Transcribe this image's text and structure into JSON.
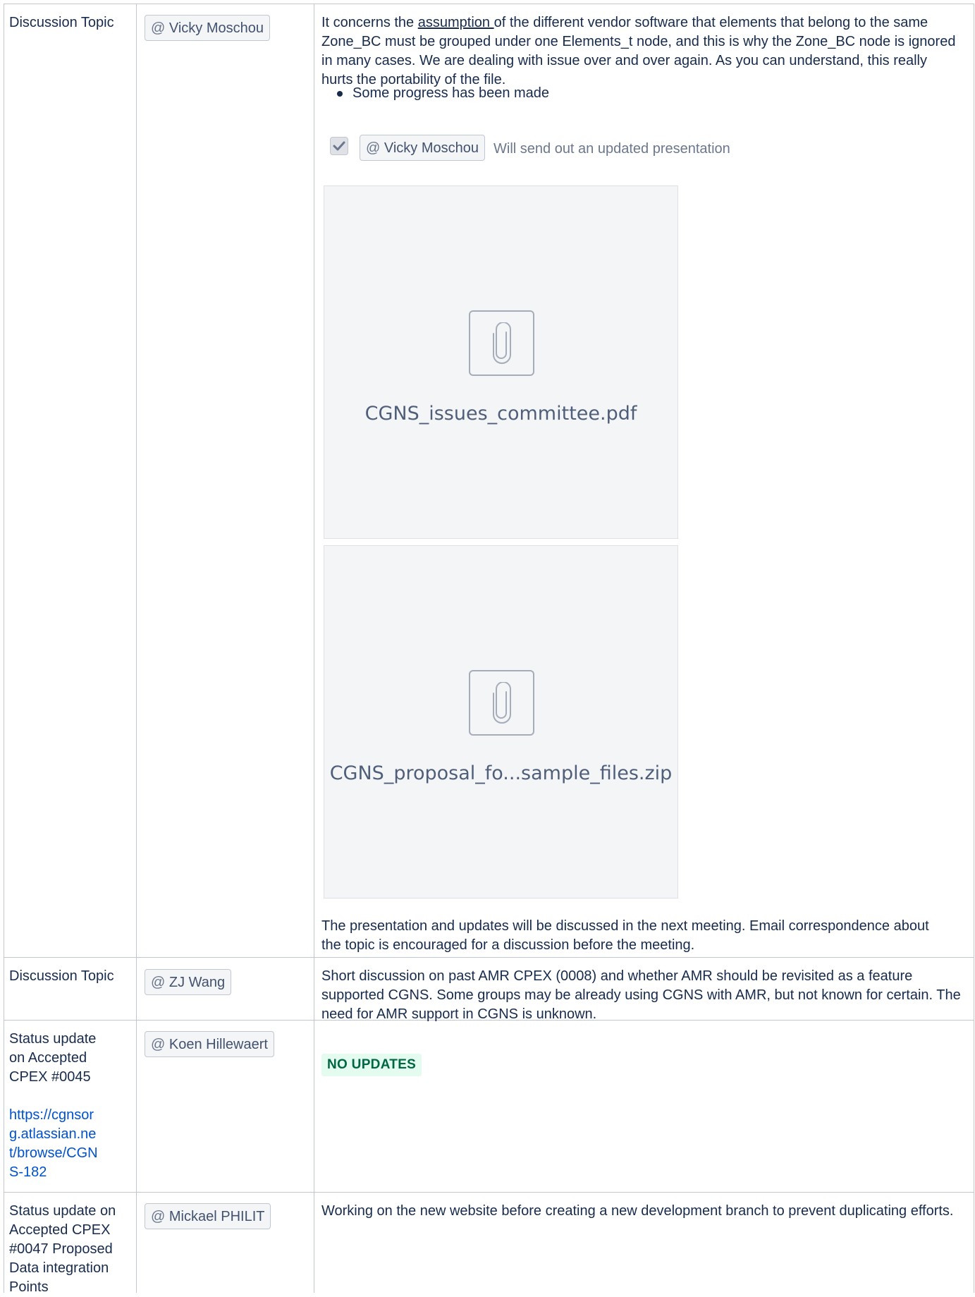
{
  "rows": [
    {
      "topic": "Discussion Topic",
      "mention": "Vicky Moschou",
      "para1_before": "It concerns the ",
      "para1_underlined": "assumption ",
      "para1_after": "of the different vendor software that elements that belong to the same Zone_BC must be grouped under one Elements_t node, and this is why the Zone_BC node is ignored in many cases. We are dealing with issue over and over again. As you can understand, this really hurts the portability of the file.",
      "bullet": "Some progress has been made",
      "task": {
        "checked": true,
        "mention": "Vicky Moschou",
        "text": "Will send out an updated presentation"
      },
      "attachments": [
        {
          "filename": "CGNS_issues_committee.pdf",
          "icon": "paperclip-icon"
        },
        {
          "filename": "CGNS_proposal_fo...sample_files.zip",
          "icon": "paperclip-icon"
        }
      ],
      "closing": "The presentation and updates will be discussed in the next meeting. Email correspondence about the topic is encouraged for a discussion before the meeting."
    },
    {
      "topic": "Discussion Topic",
      "mention": "ZJ Wang",
      "text": "Short discussion on past AMR CPEX (0008) and whether AMR should be revisited as a feature supported CGNS. Some groups may be already using CGNS with AMR, but not known for certain. The need for AMR support in CGNS is unknown."
    },
    {
      "topic": "Status update on Accepted CPEX #0045",
      "link": "https://cgnsorg.atlassian.net/browse/CGNS-182",
      "mention": "Koen Hillewaert",
      "status": "NO UPDATES",
      "status_color": "#006644"
    },
    {
      "topic": "Status update on Accepted CPEX #0047 Proposed Data integration Points",
      "mention": "Mickael PHILIT",
      "text": "Working on the new website before creating a new development branch to prevent duplicating efforts."
    }
  ],
  "mention_prefix": "@",
  "colors": {
    "border": "#c1c7d0",
    "link": "#0052cc",
    "text": "#172b4d"
  }
}
